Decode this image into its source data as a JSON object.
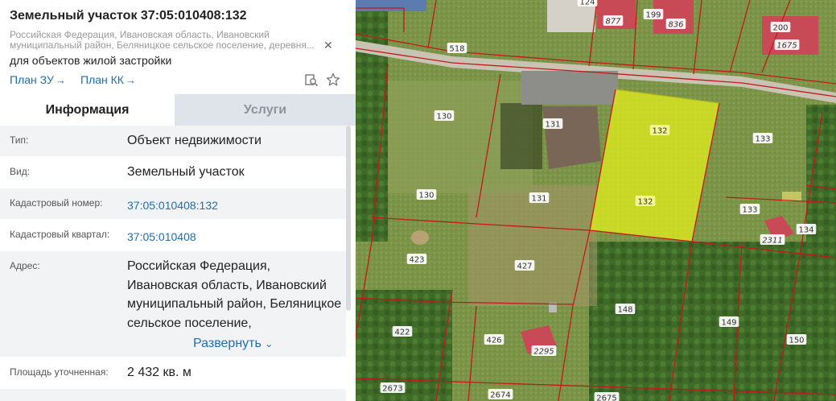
{
  "title": "Земельный участок 37:05:010408:132",
  "address_short": "Российская Федерация, Ивановская область, Ивановский муниципальный район, Беляницкое сельское поселение, деревня...",
  "purpose": "для объектов жилой застройки",
  "links": {
    "plan_zu": "План ЗУ",
    "plan_kk": "План КК",
    "arrow": "→"
  },
  "tabs": {
    "info": "Информация",
    "services": "Услуги"
  },
  "rows": {
    "type_label": "Тип:",
    "type_value": "Объект недвижимости",
    "kind_label": "Вид:",
    "kind_value": "Земельный участок",
    "cad_label": "Кадастровый номер:",
    "cad_value": "37:05:010408:132",
    "quarter_label": "Кадастровый квартал:",
    "quarter_value": "37:05:010408",
    "address_label": "Адрес:",
    "address_value": "Российская Федерация, Ивановская область, Ивановский муниципальный район, Беляницкое сельское поселение,",
    "expand": "Развернуть",
    "area_label": "Площадь уточненная:",
    "area_value": "2 432 кв. м"
  },
  "map": {
    "selected_color": "#e3ee1c",
    "boundary_color": "#c21a1a",
    "parcel_labels": [
      {
        "text": "877",
        "kind": "building"
      },
      {
        "text": "199",
        "kind": "parcel"
      },
      {
        "text": "836",
        "kind": "building"
      },
      {
        "text": "200",
        "kind": "parcel"
      },
      {
        "text": "1675",
        "kind": "building"
      },
      {
        "text": "518",
        "kind": "parcel"
      },
      {
        "text": "130",
        "kind": "parcel"
      },
      {
        "text": "131",
        "kind": "parcel"
      },
      {
        "text": "132",
        "kind": "selected"
      },
      {
        "text": "132",
        "kind": "selected"
      },
      {
        "text": "133",
        "kind": "parcel"
      },
      {
        "text": "130",
        "kind": "parcel"
      },
      {
        "text": "131",
        "kind": "parcel"
      },
      {
        "text": "133",
        "kind": "parcel"
      },
      {
        "text": "2311",
        "kind": "building"
      },
      {
        "text": "134",
        "kind": "parcel"
      },
      {
        "text": "423",
        "kind": "parcel"
      },
      {
        "text": "427",
        "kind": "parcel"
      },
      {
        "text": "148",
        "kind": "parcel"
      },
      {
        "text": "149",
        "kind": "parcel"
      },
      {
        "text": "422",
        "kind": "parcel"
      },
      {
        "text": "426",
        "kind": "parcel"
      },
      {
        "text": "2295",
        "kind": "building"
      },
      {
        "text": "150",
        "kind": "parcel"
      },
      {
        "text": "2673",
        "kind": "parcel"
      },
      {
        "text": "2674",
        "kind": "parcel"
      },
      {
        "text": "2675",
        "kind": "parcel"
      },
      {
        "text": "124",
        "kind": "parcel"
      }
    ]
  }
}
